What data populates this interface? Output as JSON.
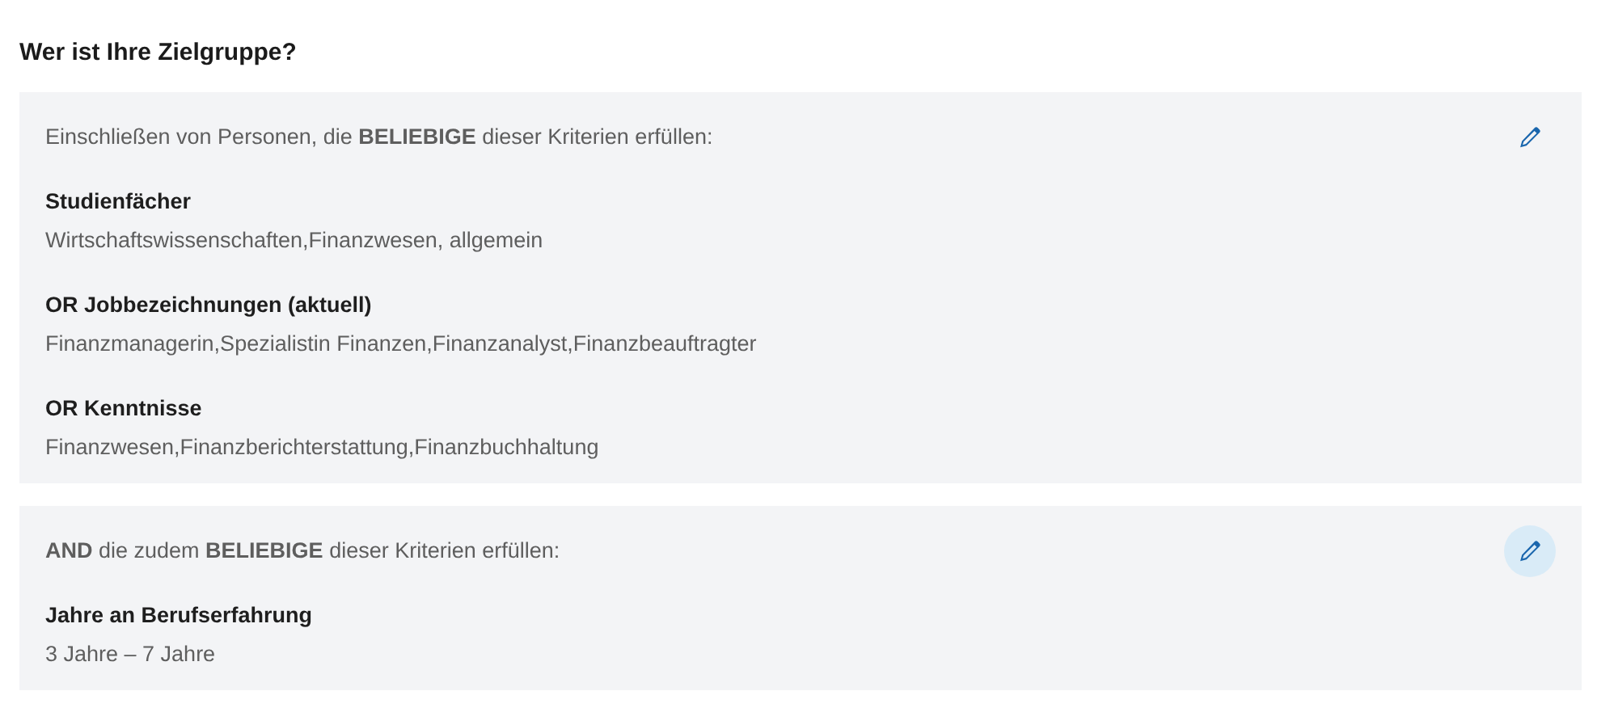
{
  "heading": "Wer ist Ihre Zielgruppe?",
  "groups": [
    {
      "intro": "Einschließen von Personen, die **BELIEBIGE** dieser Kriterien erfüllen:",
      "edit_hovered": false,
      "criteria": [
        {
          "title": "Studienfächer",
          "values": "Wirtschaftswissenschaften,Finanzwesen, allgemein"
        },
        {
          "title": "OR Jobbezeichnungen (aktuell)",
          "values": "Finanzmanagerin,Spezialistin Finanzen,Finanzanalyst,Finanzbeauftragter"
        },
        {
          "title": "OR Kenntnisse",
          "values": "Finanzwesen,Finanzberichterstattung,Finanzbuchhaltung"
        }
      ]
    },
    {
      "intro": "**AND** die zudem **BELIEBIGE** dieser Kriterien erfüllen:",
      "edit_hovered": true,
      "criteria": [
        {
          "title": "Jahre an Berufserfahrung",
          "values": "3 Jahre – 7 Jahre"
        }
      ]
    }
  ]
}
